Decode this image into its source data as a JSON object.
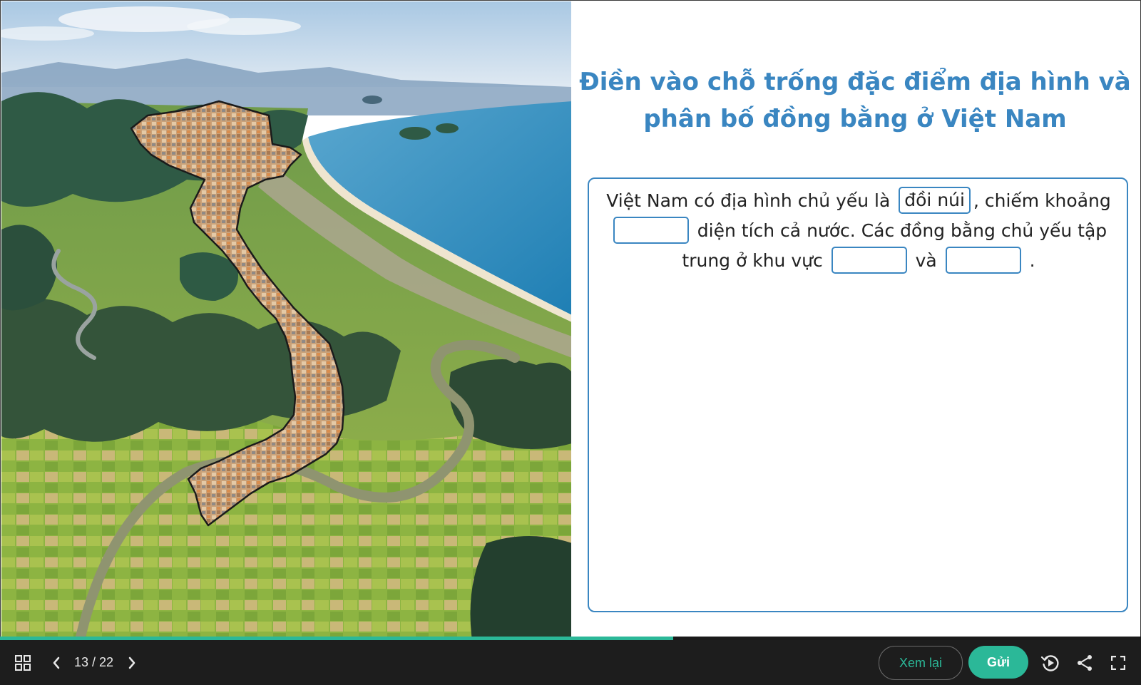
{
  "slide": {
    "title": "Điền vào chỗ trống đặc điểm địa hình và phân bố đồng bằng ở Việt Nam",
    "sentence": {
      "part1": "Việt Nam có địa hình chủ yếu là",
      "blank1_value": "đồi núi",
      "part2": ", chiếm khoảng",
      "blank2_value": "",
      "part3": "diện tích cả nước. Các đồng bằng chủ yếu tập trung ở khu vực",
      "blank3_value": "",
      "part4": "và",
      "blank4_value": "",
      "part5": "."
    }
  },
  "progress": {
    "fraction": 0.59
  },
  "toolbar": {
    "counter": "13 / 22",
    "review_label": "Xem lại",
    "submit_label": "Gửi"
  },
  "icons": {
    "grid": "grid-icon",
    "prev": "chevron-left-icon",
    "next": "chevron-right-icon",
    "replay": "replay-icon",
    "share": "share-icon",
    "fullscreen": "fullscreen-icon"
  },
  "colors": {
    "accent": "#3a86c1",
    "teal": "#2bb898",
    "toolbar_bg": "#1d1d1d"
  }
}
